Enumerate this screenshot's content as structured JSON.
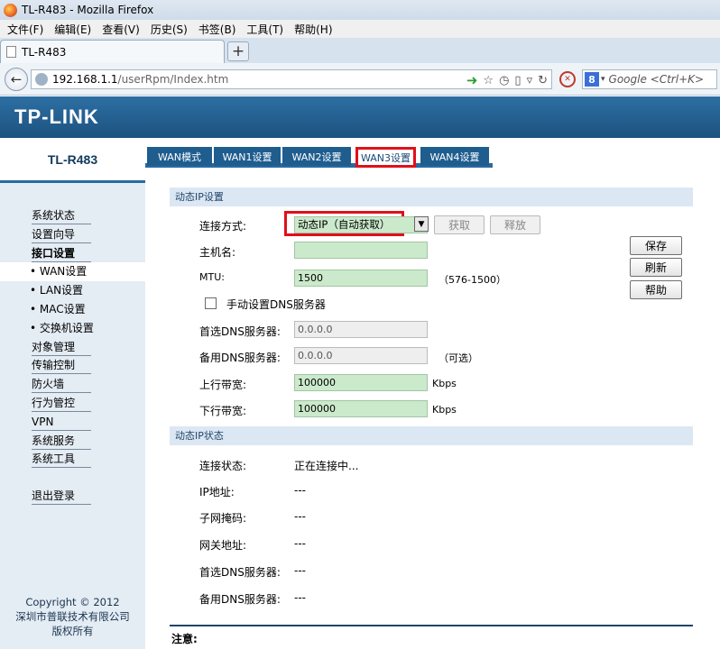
{
  "window": {
    "title": "TL-R483 - Mozilla Firefox"
  },
  "menubar": [
    "文件(F)",
    "编辑(E)",
    "查看(V)",
    "历史(S)",
    "书签(B)",
    "工具(T)",
    "帮助(H)"
  ],
  "browser": {
    "tab_title": "TL-R483",
    "new_tab": "+",
    "url_host": "192.168.1.1",
    "url_path": "/userRpm/Index.htm",
    "search_placeholder": "Google <Ctrl+K>",
    "search_engine_badge": "8"
  },
  "header": {
    "logo": "TP-LINK"
  },
  "sidebar": {
    "model": "TL-R483",
    "items": [
      {
        "label": "系统状态",
        "type": "main"
      },
      {
        "label": "设置向导",
        "type": "main"
      },
      {
        "label": "接口设置",
        "type": "bold"
      },
      {
        "label": "• WAN设置",
        "type": "sub-active"
      },
      {
        "label": "• LAN设置",
        "type": "sub"
      },
      {
        "label": "• MAC设置",
        "type": "sub"
      },
      {
        "label": "• 交换机设置",
        "type": "sub"
      },
      {
        "label": "对象管理",
        "type": "main"
      },
      {
        "label": "传输控制",
        "type": "main"
      },
      {
        "label": "防火墙",
        "type": "main"
      },
      {
        "label": "行为管控",
        "type": "main"
      },
      {
        "label": "VPN",
        "type": "main"
      },
      {
        "label": "系统服务",
        "type": "main"
      },
      {
        "label": "系统工具",
        "type": "main"
      },
      {
        "label": "退出登录",
        "type": "main"
      }
    ],
    "copyright": [
      "Copyright © 2012",
      "深圳市普联技术有限公司",
      "版权所有"
    ]
  },
  "wan_tabs": [
    "WAN模式",
    "WAN1设置",
    "WAN2设置",
    "WAN3设置",
    "WAN4设置"
  ],
  "form": {
    "section1": "动态IP设置",
    "conn_label": "连接方式:",
    "conn_value": "动态IP（自动获取）",
    "obtain_button": "获取",
    "release_button": "释放",
    "hostname_label": "主机名:",
    "hostname_value": "",
    "mtu_label": "MTU:",
    "mtu_value": "1500",
    "mtu_hint": "（576-1500）",
    "manual_dns_label": "手动设置DNS服务器",
    "dns1_label": "首选DNS服务器:",
    "dns1_value": "0.0.0.0",
    "dns2_label": "备用DNS服务器:",
    "dns2_value": "0.0.0.0",
    "dns2_hint": "（可选）",
    "up_label": "上行带宽:",
    "up_value": "100000",
    "up_unit": "Kbps",
    "down_label": "下行带宽:",
    "down_value": "100000",
    "down_unit": "Kbps",
    "save_button": "保存",
    "refresh_button": "刷新",
    "help_button": "帮助"
  },
  "status": {
    "section2": "动态IP状态",
    "rows": [
      {
        "label": "连接状态:",
        "value": "正在连接中..."
      },
      {
        "label": "IP地址:",
        "value": "---"
      },
      {
        "label": "子网掩码:",
        "value": "---"
      },
      {
        "label": "网关地址:",
        "value": "---"
      },
      {
        "label": "首选DNS服务器:",
        "value": "---"
      },
      {
        "label": "备用DNS服务器:",
        "value": "---"
      }
    ]
  },
  "note": "注意:"
}
